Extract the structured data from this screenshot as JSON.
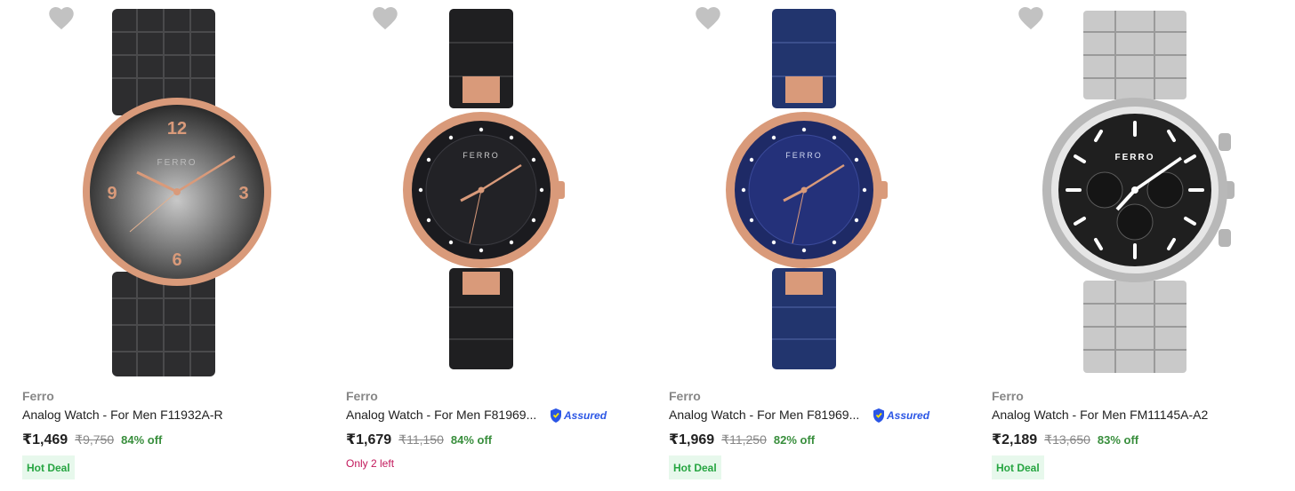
{
  "colors": {
    "brand_text": "#878787",
    "title_text": "#212121",
    "discount_green": "#388e3c",
    "deal_bg": "#e7f8ec",
    "deal_text": "#26a541",
    "low_stock": "#c2185b",
    "assured_blue": "#2a55e5",
    "wishlist_grey": "#c2c2c2"
  },
  "products": [
    {
      "brand": "Ferro",
      "title": "Analog Watch - For Men F11932A-R",
      "price": "₹1,469",
      "mrp": "₹9,750",
      "discount": "84% off",
      "badge": "Hot Deal",
      "image_icon": "watch-black-rosegold-icon",
      "dial_brand": "FERRO"
    },
    {
      "brand": "Ferro",
      "title": "Analog Watch - For Men F81969...",
      "assured_label": "Assured",
      "price": "₹1,679",
      "mrp": "₹11,150",
      "discount": "84% off",
      "stock_note": "Only 2 left",
      "image_icon": "watch-black-ceramic-icon",
      "dial_brand": "FERRO"
    },
    {
      "brand": "Ferro",
      "title": "Analog Watch - For Men F81969...",
      "assured_label": "Assured",
      "price": "₹1,969",
      "mrp": "₹11,250",
      "discount": "82% off",
      "badge": "Hot Deal",
      "image_icon": "watch-blue-ceramic-icon",
      "dial_brand": "FERRO"
    },
    {
      "brand": "Ferro",
      "title": "Analog Watch - For Men FM11145A-A2",
      "price": "₹2,189",
      "mrp": "₹13,650",
      "discount": "83% off",
      "badge": "Hot Deal",
      "image_icon": "watch-silver-chronograph-icon",
      "dial_brand": "FERRO"
    }
  ]
}
